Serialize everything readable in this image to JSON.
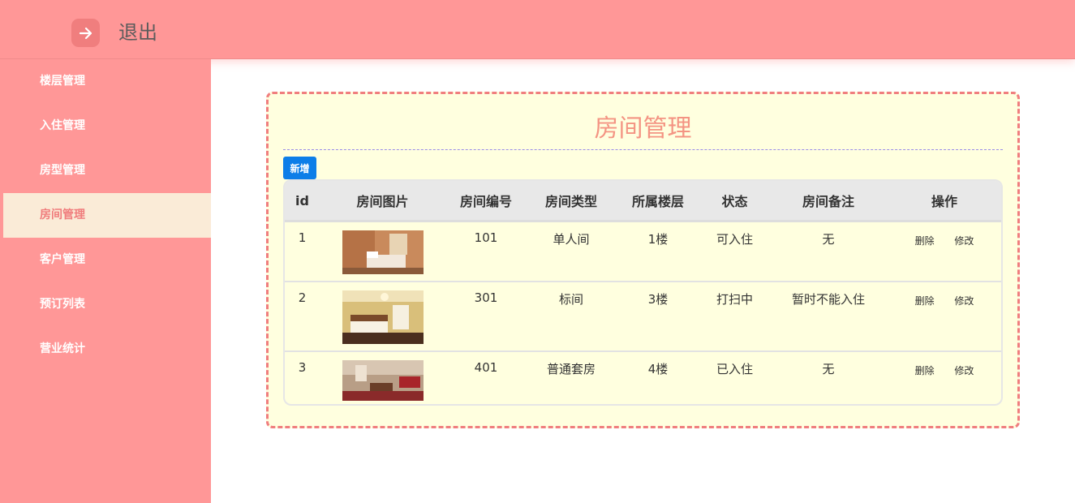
{
  "header": {
    "logout_label": "退出",
    "icon": "arrow-right-icon",
    "colors": {
      "bar": "#ff9797",
      "icon_bg": "#f07e7e"
    }
  },
  "sidebar": {
    "items": [
      {
        "label": "楼层管理",
        "active": false
      },
      {
        "label": "入住管理",
        "active": false
      },
      {
        "label": "房型管理",
        "active": false
      },
      {
        "label": "房间管理",
        "active": true
      },
      {
        "label": "客户管理",
        "active": false
      },
      {
        "label": "预订列表",
        "active": false
      },
      {
        "label": "营业统计",
        "active": false
      }
    ]
  },
  "panel": {
    "title": "房间管理",
    "add_label": "新增",
    "colors": {
      "border": "#f07e7e",
      "background": "#ffffdf",
      "add_button": "#0d7ee8"
    }
  },
  "table": {
    "headers": [
      "id",
      "房间图片",
      "房间编号",
      "房间类型",
      "所属楼层",
      "状态",
      "房间备注",
      "操作"
    ],
    "rows": [
      {
        "id": "1",
        "image": "single-room-photo",
        "number": "101",
        "type": "单人间",
        "floor": "1楼",
        "status": "可入住",
        "note": "无",
        "delete": "删除",
        "edit": "修改"
      },
      {
        "id": "2",
        "image": "standard-room-photo",
        "number": "301",
        "type": "标间",
        "floor": "3楼",
        "status": "打扫中",
        "note": "暂时不能入住",
        "delete": "删除",
        "edit": "修改"
      },
      {
        "id": "3",
        "image": "suite-room-photo",
        "number": "401",
        "type": "普通套房",
        "floor": "4楼",
        "status": "已入住",
        "note": "无",
        "delete": "删除",
        "edit": "修改"
      }
    ]
  }
}
